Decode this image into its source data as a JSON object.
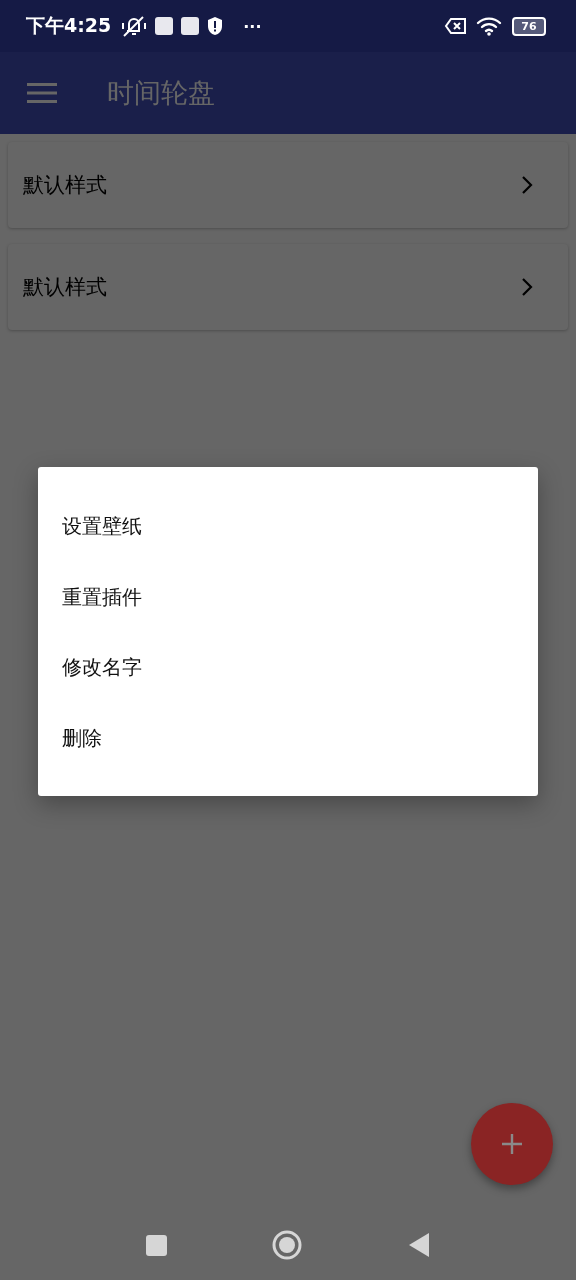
{
  "status_bar": {
    "time": "下午4:25",
    "more": "···",
    "battery": "76"
  },
  "app_bar": {
    "title": "时间轮盘"
  },
  "list": [
    {
      "label": "默认样式"
    },
    {
      "label": "默认样式"
    }
  ],
  "dialog": {
    "items": [
      {
        "label": "设置壁纸"
      },
      {
        "label": "重置插件"
      },
      {
        "label": "修改名字"
      },
      {
        "label": "删除"
      }
    ]
  }
}
